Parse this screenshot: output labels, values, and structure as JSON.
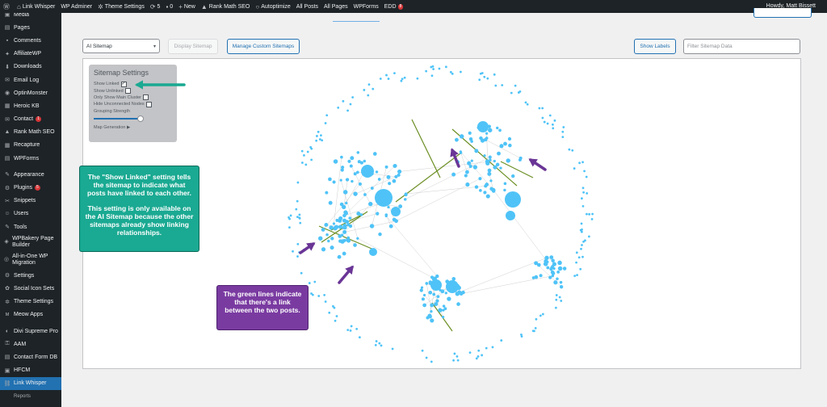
{
  "admin_bar": {
    "items": [
      {
        "icon": "wordpress-icon",
        "glyph": "Ⓦ",
        "label": ""
      },
      {
        "icon": "home-icon",
        "glyph": "⌂",
        "label": "Link Whisper"
      },
      {
        "icon": "",
        "glyph": "",
        "label": "WP Adminer"
      },
      {
        "icon": "gear-icon",
        "glyph": "✲",
        "label": "Theme Settings"
      },
      {
        "icon": "refresh-icon",
        "glyph": "⟳",
        "label": "5"
      },
      {
        "icon": "comment-icon",
        "glyph": "▪",
        "label": "0"
      },
      {
        "icon": "plus-icon",
        "glyph": "+",
        "label": "New"
      },
      {
        "icon": "rankmath-icon",
        "glyph": "▲",
        "label": "Rank Math SEO"
      },
      {
        "icon": "status-dot-icon",
        "glyph": "○",
        "label": "Autoptimize"
      },
      {
        "icon": "",
        "glyph": "",
        "label": "All Posts"
      },
      {
        "icon": "",
        "glyph": "",
        "label": "All Pages"
      },
      {
        "icon": "",
        "glyph": "",
        "label": "WPForms"
      },
      {
        "icon": "",
        "glyph": "",
        "label": "EDD",
        "badge": "8"
      }
    ],
    "howdy": "Howdy, Matt Bissett"
  },
  "sidebar": {
    "items": [
      {
        "icon": "media-icon",
        "glyph": "▣",
        "label": "Media"
      },
      {
        "icon": "pages-icon",
        "glyph": "▤",
        "label": "Pages"
      },
      {
        "icon": "comments-icon",
        "glyph": "▪",
        "label": "Comments"
      },
      {
        "icon": "affiliate-icon",
        "glyph": "✦",
        "label": "AffiliateWP"
      },
      {
        "icon": "downloads-icon",
        "glyph": "⬇",
        "label": "Downloads"
      },
      {
        "icon": "email-icon",
        "glyph": "✉",
        "label": "Email Log"
      },
      {
        "icon": "optinmonster-icon",
        "glyph": "◉",
        "label": "OptinMonster"
      },
      {
        "icon": "heroic-kb-icon",
        "glyph": "▦",
        "label": "Heroic KB"
      },
      {
        "icon": "contact-icon",
        "glyph": "✉",
        "label": "Contact",
        "badge": "1"
      },
      {
        "icon": "rankmath-icon",
        "glyph": "▲",
        "label": "Rank Math SEO"
      },
      {
        "icon": "recapture-icon",
        "glyph": "▦",
        "label": "Recapture"
      },
      {
        "icon": "wpforms-icon",
        "glyph": "▤",
        "label": "WPForms"
      },
      {
        "icon": "appearance-icon",
        "glyph": "✎",
        "label": "Appearance",
        "sep": true
      },
      {
        "icon": "plugins-icon",
        "glyph": "⚙",
        "label": "Plugins",
        "badge": "5"
      },
      {
        "icon": "snippets-icon",
        "glyph": "✂",
        "label": "Snippets"
      },
      {
        "icon": "users-icon",
        "glyph": "☺",
        "label": "Users"
      },
      {
        "icon": "tools-icon",
        "glyph": "✎",
        "label": "Tools"
      },
      {
        "icon": "wpbakery-icon",
        "glyph": "◈",
        "label": "WPBakery Page Builder",
        "tall": true
      },
      {
        "icon": "migration-icon",
        "glyph": "◎",
        "label": "All-in-One WP Migration",
        "tall": true
      },
      {
        "icon": "settings-icon",
        "glyph": "⚙",
        "label": "Settings"
      },
      {
        "icon": "icon-sets-icon",
        "glyph": "✿",
        "label": "Social Icon Sets"
      },
      {
        "icon": "gear-icon",
        "glyph": "✲",
        "label": "Theme Settings"
      },
      {
        "icon": "meow-icon",
        "glyph": "ᴍ",
        "label": "Meow Apps"
      },
      {
        "icon": "divi-icon",
        "glyph": "◐",
        "label": "Divi Supreme Pro",
        "sep": true
      },
      {
        "icon": "aam-icon",
        "glyph": "⚿",
        "label": "AAM"
      },
      {
        "icon": "database-icon",
        "glyph": "▤",
        "label": "Contact Form DB"
      },
      {
        "icon": "hfcm-icon",
        "glyph": "▣",
        "label": "HFCM"
      },
      {
        "icon": "link-whisper-icon",
        "glyph": "⛓",
        "label": "Link Whisper",
        "active": true
      },
      {
        "icon": "",
        "glyph": "",
        "label": "Reports"
      }
    ]
  },
  "toolbar": {
    "sitemap_select": "AI Sitemap",
    "display_sitemap": "Display Sitemap",
    "manage_custom": "Manage Custom Sitemaps",
    "show_labels": "Show Labels",
    "filter_placeholder": "Filter Sitemap Data"
  },
  "settings_panel": {
    "title": "Sitemap Settings",
    "options": [
      {
        "label": "Show Linked",
        "checked": true
      },
      {
        "label": "Show Unlinked",
        "checked": false
      },
      {
        "label": "Only Show Main Cluster",
        "checked": false
      },
      {
        "label": "Hide Unconnected Nodes",
        "checked": false
      }
    ],
    "grouping_label": "Grouping Strength",
    "grouping_value": 0.92,
    "map_generation": "Map Generation ▶"
  },
  "callouts": {
    "show_linked_p1": "The \"Show Linked\" setting tells the sitemap to indicate what posts have linked to each other.",
    "show_linked_p2": "This setting is only available on the AI Sitemap because the other sitemaps already show linking relationships.",
    "green_lines": "The green lines indicate that there's a link between the two posts."
  },
  "colors": {
    "node": "#4fc3f7",
    "edge": "#cfcfcf",
    "link_edge": "#6b8e23",
    "arrow_green": "#1aa992",
    "arrow_purple": "#6a3596",
    "accent": "#2271b1"
  }
}
